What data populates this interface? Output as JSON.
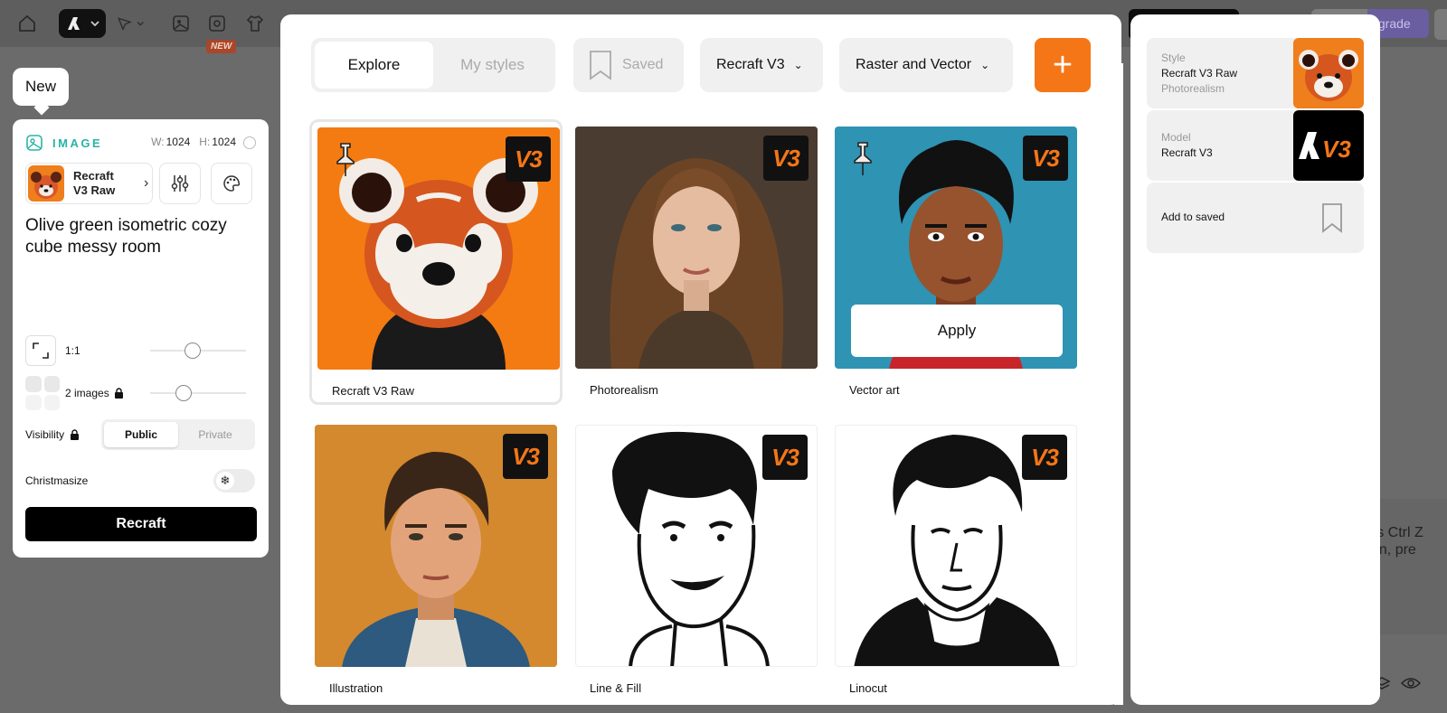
{
  "topbar": {
    "new_tag": "NEW",
    "upgrade_label": "Upgrade"
  },
  "new_bubble": {
    "label": "New"
  },
  "left_panel": {
    "section_title": "IMAGE",
    "width_label": "W:",
    "width_value": "1024",
    "height_label": "H:",
    "height_value": "1024",
    "style_chip_label": "Recraft V3 Raw",
    "prompt": "Olive green isometric cozy cube messy room",
    "aspect_ratio": "1:1",
    "images_count": "2 images",
    "visibility_label": "Visibility",
    "visibility_options": [
      "Public",
      "Private"
    ],
    "visibility_selected": "Public",
    "christmasize_label": "Christmasize",
    "christmasize_on": false,
    "generate_button": "Recraft"
  },
  "modal": {
    "tabs": [
      "Explore",
      "My styles"
    ],
    "active_tab": "Explore",
    "saved_label": "Saved",
    "model_dropdown": "Recraft V3",
    "type_dropdown": "Raster and Vector",
    "add_label": "+",
    "badge": "V3",
    "apply_label": "Apply",
    "styles": [
      {
        "name": "Recraft V3 Raw",
        "selected": true,
        "pinned": true
      },
      {
        "name": "Photorealism",
        "selected": false,
        "pinned": false
      },
      {
        "name": "Vector art",
        "selected": false,
        "pinned": true
      },
      {
        "name": "Illustration",
        "selected": false,
        "pinned": false
      },
      {
        "name": "Line & Fill",
        "selected": false,
        "pinned": false
      },
      {
        "name": "Linocut",
        "selected": false,
        "pinned": false
      }
    ]
  },
  "right_panel": {
    "style_title": "Style",
    "style_name": "Recraft V3 Raw",
    "style_sub": "Photorealism",
    "model_title": "Model",
    "model_name": "Recraft V3",
    "add_to_saved": "Add to saved"
  },
  "background": {
    "hint_line1": "ress Ctrl Z",
    "hint_line2": "ction, pre"
  },
  "colors": {
    "accent": "#f47617",
    "teal": "#2bb3a4",
    "overlay": "#6b6b6b"
  }
}
